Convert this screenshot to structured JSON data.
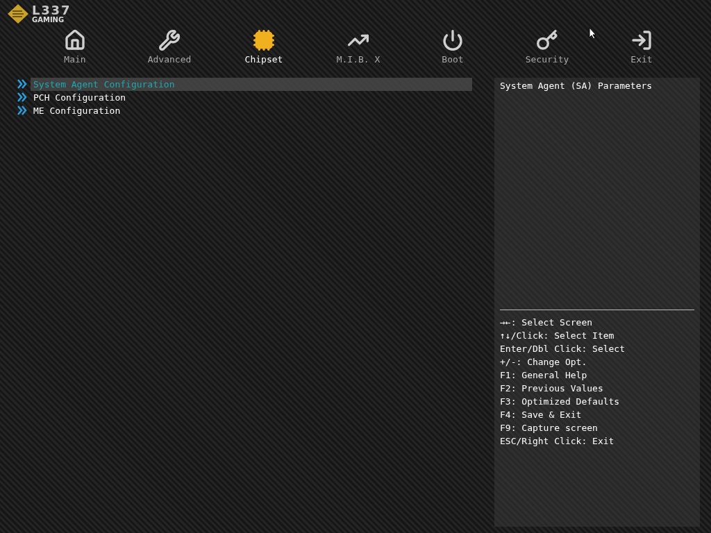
{
  "logo": {
    "wordmark": "L337",
    "subtitle": "GAMING"
  },
  "tabs": [
    {
      "label": "Main",
      "kind": "home",
      "selected": false
    },
    {
      "label": "Advanced",
      "kind": "tools",
      "selected": false
    },
    {
      "label": "Chipset",
      "kind": "chipset",
      "selected": true
    },
    {
      "label": "M.I.B. X",
      "kind": "tuning",
      "selected": false
    },
    {
      "label": "Boot",
      "kind": "boot",
      "selected": false
    },
    {
      "label": "Security",
      "kind": "security",
      "selected": false
    },
    {
      "label": "Exit",
      "kind": "exit",
      "selected": false
    }
  ],
  "menu_items": [
    {
      "label": "System Agent Configuration",
      "selected": true
    },
    {
      "label": "PCH Configuration",
      "selected": false
    },
    {
      "label": "ME Configuration",
      "selected": false
    }
  ],
  "help_text": "System Agent (SA) Parameters",
  "key_legend": [
    "→←: Select Screen",
    "↑↓/Click: Select Item",
    "Enter/Dbl Click: Select",
    "+/-: Change Opt.",
    "F1: General Help",
    "F2: Previous Values",
    "F3: Optimized Defaults",
    "F4: Save & Exit",
    "F9: Capture screen",
    "ESC/Right Click: Exit"
  ]
}
